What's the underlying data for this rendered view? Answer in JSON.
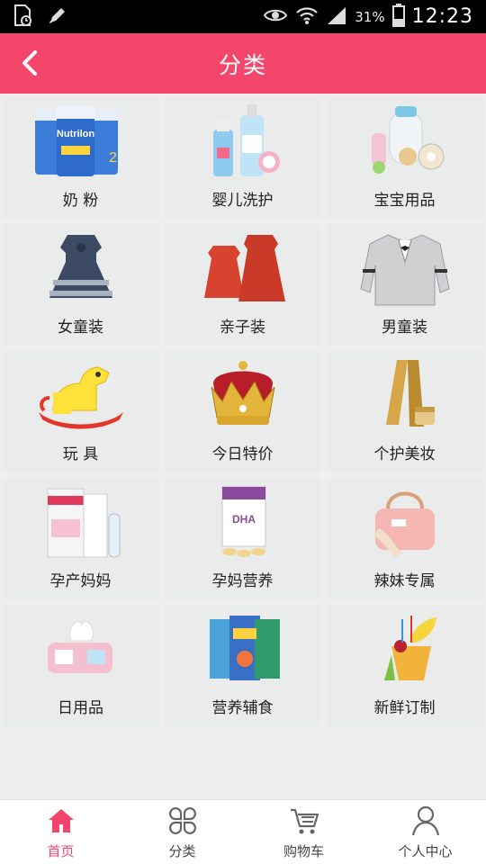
{
  "status_bar": {
    "battery": "31%",
    "time": "12:23"
  },
  "header": {
    "title": "分类",
    "back_icon": "chevron-left-icon"
  },
  "categories": [
    {
      "label": "奶 粉",
      "icon": "milk-powder-icon"
    },
    {
      "label": "婴儿洗护",
      "icon": "baby-wash-icon"
    },
    {
      "label": "宝宝用品",
      "icon": "baby-supplies-icon"
    },
    {
      "label": "女童装",
      "icon": "girls-dress-icon"
    },
    {
      "label": "亲子装",
      "icon": "family-outfit-icon"
    },
    {
      "label": "男童装",
      "icon": "boys-cardigan-icon"
    },
    {
      "label": "玩 具",
      "icon": "toy-horse-icon"
    },
    {
      "label": "今日特价",
      "icon": "crown-icon"
    },
    {
      "label": "个护美妆",
      "icon": "cosmetics-icon"
    },
    {
      "label": "孕产妈妈",
      "icon": "maternity-box-icon"
    },
    {
      "label": "孕妈营养",
      "icon": "dha-supplement-icon"
    },
    {
      "label": "辣妹专属",
      "icon": "handbag-icon"
    },
    {
      "label": "日用品",
      "icon": "tissue-icon"
    },
    {
      "label": "营养辅食",
      "icon": "baby-food-icon"
    },
    {
      "label": "新鲜订制",
      "icon": "fresh-fruit-icon"
    }
  ],
  "bottom_nav": [
    {
      "label": "首页",
      "icon": "home-icon",
      "active": true
    },
    {
      "label": "分类",
      "icon": "category-icon",
      "active": false
    },
    {
      "label": "购物车",
      "icon": "cart-icon",
      "active": false
    },
    {
      "label": "个人中心",
      "icon": "user-icon",
      "active": false
    }
  ],
  "colors": {
    "accent": "#f4466b",
    "cell_bg": "#eaebeb",
    "page_bg": "#eeeeee"
  }
}
